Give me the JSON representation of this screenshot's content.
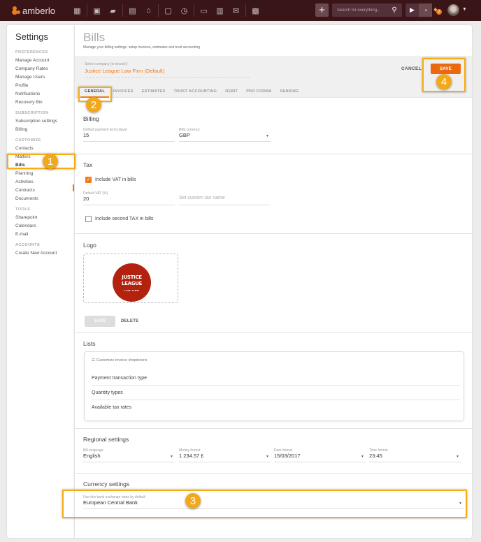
{
  "topbar": {
    "brand": "amberlo",
    "nav_icons": [
      "dashboard-icon",
      "contacts-icon",
      "matters-icon",
      "bills-icon",
      "trust-accounting-icon",
      "calendar-icon",
      "time-tracking-icon",
      "documents-icon",
      "file-edit-icon",
      "email-icon",
      "reports-icon"
    ],
    "search_placeholder": "Search for everything...",
    "notification_count": "2",
    "accent_color": "#f07b1b"
  },
  "sidebar": {
    "title": "Settings",
    "groups": [
      {
        "label": "PREFERENCES",
        "items": [
          "Manage Account",
          "Company Rates",
          "Manage Users",
          "Profile",
          "Notifications",
          "Recovery Bin"
        ]
      },
      {
        "label": "SUBSCRIPTION",
        "items": [
          "Subscription settings",
          "Billing"
        ]
      },
      {
        "label": "CUSTOMIZE",
        "items": [
          "Contacts",
          "Matters",
          "Bills",
          "Planning",
          "Activities",
          "Contracts",
          "Documents"
        ]
      },
      {
        "label": "TOOLS",
        "items": [
          "Sharepoint",
          "Calendars",
          "E-mail"
        ]
      },
      {
        "label": "ACCOUNTS",
        "items": [
          "Create New Account"
        ]
      }
    ],
    "active_item": "Bills"
  },
  "main": {
    "title": "Bills",
    "subtitle": "Manage your billing settings, setup invoices, estimates and trust accounting",
    "company": {
      "label": "Select company (or branch)",
      "value": "Justice League Law Firm (Default)"
    },
    "cancel_label": "CANCEL",
    "save_label": "SAVE",
    "tabs": [
      "GENERAL",
      "INVOICES",
      "ESTIMATES",
      "TRUST ACCOUNTING",
      "DEBIT",
      "PRO FORMA",
      "SENDING"
    ],
    "active_tab": "GENERAL",
    "billing": {
      "title": "Billing",
      "payment_term_label": "Default payment term (days)",
      "payment_term_value": "15",
      "currency_label": "Bills currency",
      "currency_value": "GBP"
    },
    "tax": {
      "title": "Tax",
      "include_vat_label": "Include VAT in bills",
      "include_vat_checked": true,
      "default_vat_label": "Default VAT (%)",
      "default_vat_value": "20",
      "custom_tax_placeholder": "Set custom tax name",
      "second_tax_label": "Include second TAX in bills",
      "second_tax_checked": false
    },
    "logo": {
      "title": "Logo",
      "logo_line1": "JUSTICE",
      "logo_line2": "LEAGUE",
      "logo_line3": "LAW FIRM",
      "save_label": "SAVE",
      "delete_label": "DELETE"
    },
    "lists": {
      "title": "Lists",
      "header": "Customize invoice dropdowns",
      "items": [
        "Payment transaction type",
        "Quantity types",
        "Available tax rates"
      ]
    },
    "regional": {
      "title": "Regional settings",
      "language_label": "Bill language",
      "language_value": "English",
      "money_label": "Money format",
      "money_value": "1 234.57 £",
      "date_label": "Date format",
      "date_value": "15/03/2017",
      "time_label": "Time format",
      "time_value": "23:45"
    },
    "currency": {
      "title": "Currency settings",
      "bank_label": "Use this bank exchange rates by default",
      "bank_value": "European Central Bank"
    }
  },
  "annotations": [
    "1",
    "2",
    "3",
    "4"
  ]
}
